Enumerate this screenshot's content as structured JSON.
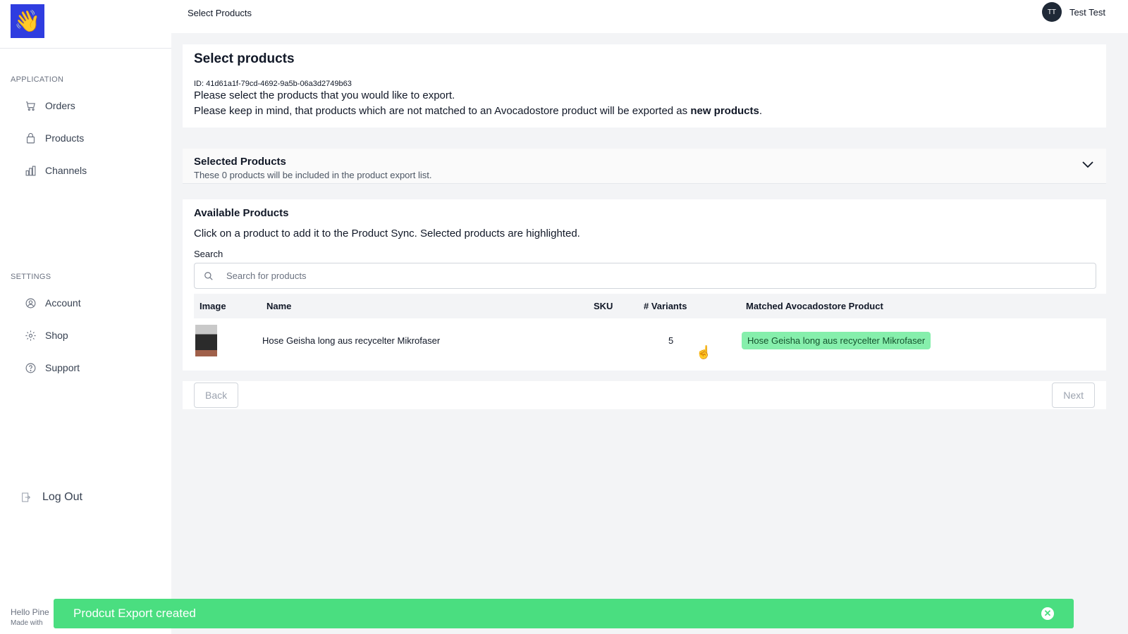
{
  "sidebar": {
    "logo_emoji": "👋",
    "application_heading": "APPLICATION",
    "application_items": [
      {
        "label": "Orders",
        "icon": "cart-icon"
      },
      {
        "label": "Products",
        "icon": "bag-icon"
      },
      {
        "label": "Channels",
        "icon": "chart-icon"
      }
    ],
    "settings_heading": "SETTINGS",
    "settings_items": [
      {
        "label": "Account",
        "icon": "user-circle-icon"
      },
      {
        "label": "Shop",
        "icon": "gear-icon"
      },
      {
        "label": "Support",
        "icon": "question-icon"
      }
    ],
    "logout_label": "Log Out",
    "footer_line1": "Hello Pine",
    "footer_line2": "Made with"
  },
  "header": {
    "title": "Select Products",
    "user_initials": "TT",
    "user_name": "Test Test"
  },
  "intro": {
    "title": "Select products",
    "id_line": "ID: 41d61a1f-79cd-4692-9a5b-06a3d2749b63",
    "line1": "Please select the products that you would like to export.",
    "line2_prefix": "Please keep in mind, that products which are not matched to an Avocadostore product will be exported as ",
    "line2_bold": "new products",
    "line2_suffix": "."
  },
  "selected": {
    "title": "Selected Products",
    "subtitle": "These 0 products will be included in the product export list."
  },
  "available": {
    "title": "Available Products",
    "description": "Click on a product to add it to the Product Sync. Selected products are highlighted.",
    "search_label": "Search",
    "search_placeholder": "Search for products",
    "columns": [
      "Image",
      "Name",
      "SKU",
      "# Variants",
      "Matched Avocadostore Product"
    ],
    "rows": [
      {
        "name": "Hose Geisha long aus recycelter Mikrofaser",
        "sku": "",
        "variants": "5",
        "matched": "Hose Geisha long aus recycelter Mikrofaser"
      }
    ]
  },
  "actions": {
    "back_label": "Back",
    "next_label": "Next"
  },
  "toast": {
    "message": "Prodcut Export created",
    "color": "#4ade80"
  }
}
